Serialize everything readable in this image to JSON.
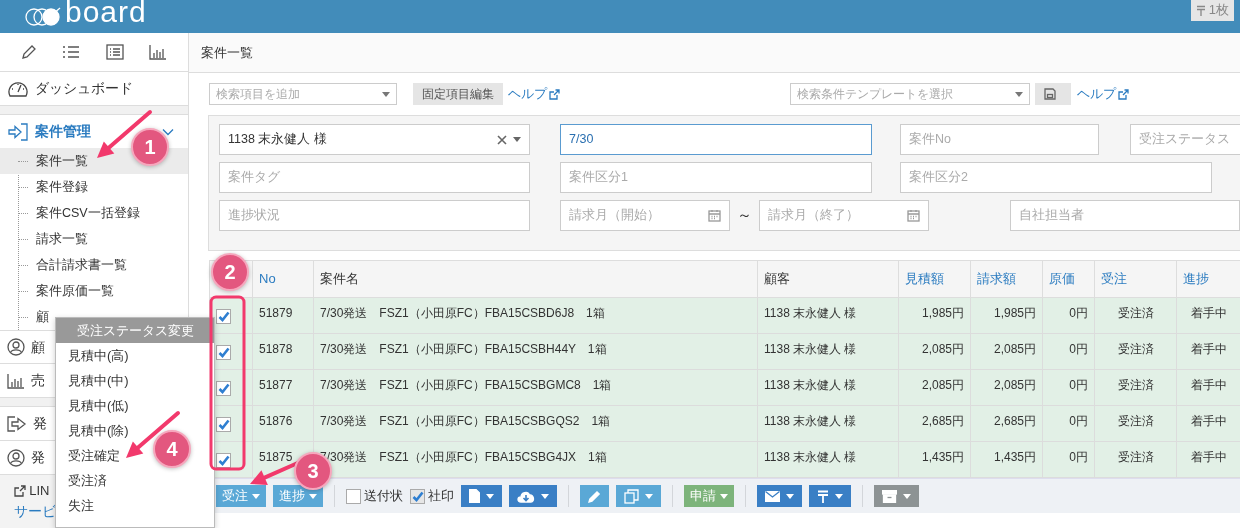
{
  "header": {
    "logo": "board",
    "badge": "1枚"
  },
  "sidebar": {
    "dashboard": "ダッシュボード",
    "section": {
      "label": "案件管理",
      "expanded": true,
      "items": [
        {
          "label": "案件一覧",
          "selected": true
        },
        {
          "label": "案件登録",
          "selected": false
        },
        {
          "label": "案件CSV一括登録",
          "selected": false
        },
        {
          "label": "請求一覧",
          "selected": false
        },
        {
          "label": "合計請求書一覧",
          "selected": false
        },
        {
          "label": "案件原価一覧",
          "selected": false
        },
        {
          "label": "顧",
          "selected": false
        }
      ]
    },
    "menus": [
      {
        "label": "顧",
        "kind": "user"
      },
      {
        "label": "売",
        "kind": "chart"
      },
      {
        "label": "発",
        "kind": "exit"
      },
      {
        "label": "発",
        "kind": "user"
      }
    ],
    "footer": {
      "link": "LIN",
      "text": "サービ"
    }
  },
  "page_title": "案件一覧",
  "search": {
    "field": {
      "placeholder": "検索項目を追加"
    },
    "edit_button": "固定項目編集",
    "help_link": "ヘルプ",
    "template": {
      "placeholder": "検索条件テンプレートを選択"
    },
    "template_help_link": "ヘルプ"
  },
  "filters": [
    [
      {
        "kind": "select",
        "value": "1138 末永健人 様"
      },
      {
        "kind": "text",
        "value": "7/30",
        "focused": true
      },
      {
        "kind": "text",
        "placeholder": "案件No",
        "focused": false
      },
      {
        "kind": "text",
        "placeholder": "受注ステータス",
        "focused": false
      }
    ],
    [
      {
        "kind": "text",
        "placeholder": "案件タグ",
        "focused": false
      },
      {
        "kind": "text",
        "placeholder": "案件区分1",
        "focused": false
      },
      {
        "kind": "text",
        "placeholder": "案件区分2",
        "focused": false
      }
    ],
    [
      {
        "kind": "text",
        "placeholder": "進捗状況",
        "focused": false
      },
      {
        "kind": "date",
        "placeholder": "請求月（開始）"
      },
      {
        "kind": "sep",
        "label": "～"
      },
      {
        "kind": "date",
        "placeholder": "請求月（終了）"
      },
      {
        "kind": "text",
        "placeholder": "自社担当者",
        "focused": false
      }
    ]
  ],
  "table": {
    "columns": [
      {
        "label": "No",
        "sortable": true
      },
      {
        "label": "案件名",
        "sortable": false
      },
      {
        "label": "顧客",
        "sortable": false
      },
      {
        "label": "見積額",
        "sortable": true
      },
      {
        "label": "請求額",
        "sortable": true
      },
      {
        "label": "原価",
        "sortable": true
      },
      {
        "label": "受注",
        "sortable": true
      },
      {
        "label": "進捗",
        "sortable": true
      }
    ],
    "rows": [
      {
        "checked": true,
        "cells": [
          "51879",
          "7/30発送　FSZ1（小田原FC）FBA15CSBD6J8　1箱",
          "1138 末永健人 様",
          "1,985円",
          "1,985円",
          "0円",
          "受注済",
          "着手中"
        ]
      },
      {
        "checked": true,
        "cells": [
          "51878",
          "7/30発送　FSZ1（小田原FC）FBA15CSBH44Y　1箱",
          "1138 末永健人 様",
          "2,085円",
          "2,085円",
          "0円",
          "受注済",
          "着手中"
        ]
      },
      {
        "checked": true,
        "cells": [
          "51877",
          "7/30発送　FSZ1（小田原FC）FBA15CSBGMC8　1箱",
          "1138 末永健人 様",
          "2,085円",
          "2,085円",
          "0円",
          "受注済",
          "着手中"
        ]
      },
      {
        "checked": true,
        "cells": [
          "51876",
          "7/30発送　FSZ1（小田原FC）FBA15CSBGQS2　1箱",
          "1138 末永健人 様",
          "2,685円",
          "2,685円",
          "0円",
          "受注済",
          "着手中"
        ]
      },
      {
        "checked": true,
        "cells": [
          "51875",
          "7/30発送　FSZ1（小田原FC）FBA15CSBG4JX　1箱",
          "1138 末永健人 様",
          "1,435円",
          "1,435円",
          "0円",
          "受注済",
          "着手中"
        ]
      }
    ]
  },
  "toolbar": [
    {
      "kind": "dropdown",
      "label": "受注",
      "color": "#5aa8d6"
    },
    {
      "kind": "dropdown",
      "label": "進捗",
      "color": "#5aa8d6"
    },
    {
      "kind": "divider"
    },
    {
      "kind": "checkbox",
      "label": "送付状",
      "checked": false
    },
    {
      "kind": "checkbox",
      "label": "社印",
      "checked": true
    },
    {
      "kind": "file",
      "color": "#3a7fc5",
      "caret": true
    },
    {
      "kind": "cloud",
      "color": "#3a7fc5",
      "caret": true
    },
    {
      "kind": "divider"
    },
    {
      "kind": "pencil",
      "color": "#5aa8d6",
      "caret": false
    },
    {
      "kind": "copy",
      "color": "#5aa8d6",
      "caret": true
    },
    {
      "kind": "divider"
    },
    {
      "kind": "dropdown",
      "label": "申請",
      "color": "#7db47b"
    },
    {
      "kind": "divider"
    },
    {
      "kind": "mail",
      "color": "#3a7fc5",
      "caret": true
    },
    {
      "kind": "postal",
      "color": "#3a7fc5",
      "caret": true
    },
    {
      "kind": "divider"
    },
    {
      "kind": "archive",
      "color": "#8d9394",
      "caret": true
    }
  ],
  "status_menu": {
    "title": "受注ステータス変更",
    "items": [
      "見積中(高)",
      "見積中(中)",
      "見積中(低)",
      "見積中(除)",
      "受注確定",
      "受注済",
      "失注"
    ]
  },
  "annotations": [
    {
      "number": "1",
      "kind": "arrow"
    },
    {
      "number": "2",
      "kind": "frame"
    },
    {
      "number": "3",
      "kind": "arrow"
    },
    {
      "number": "4",
      "kind": "arrow"
    }
  ]
}
